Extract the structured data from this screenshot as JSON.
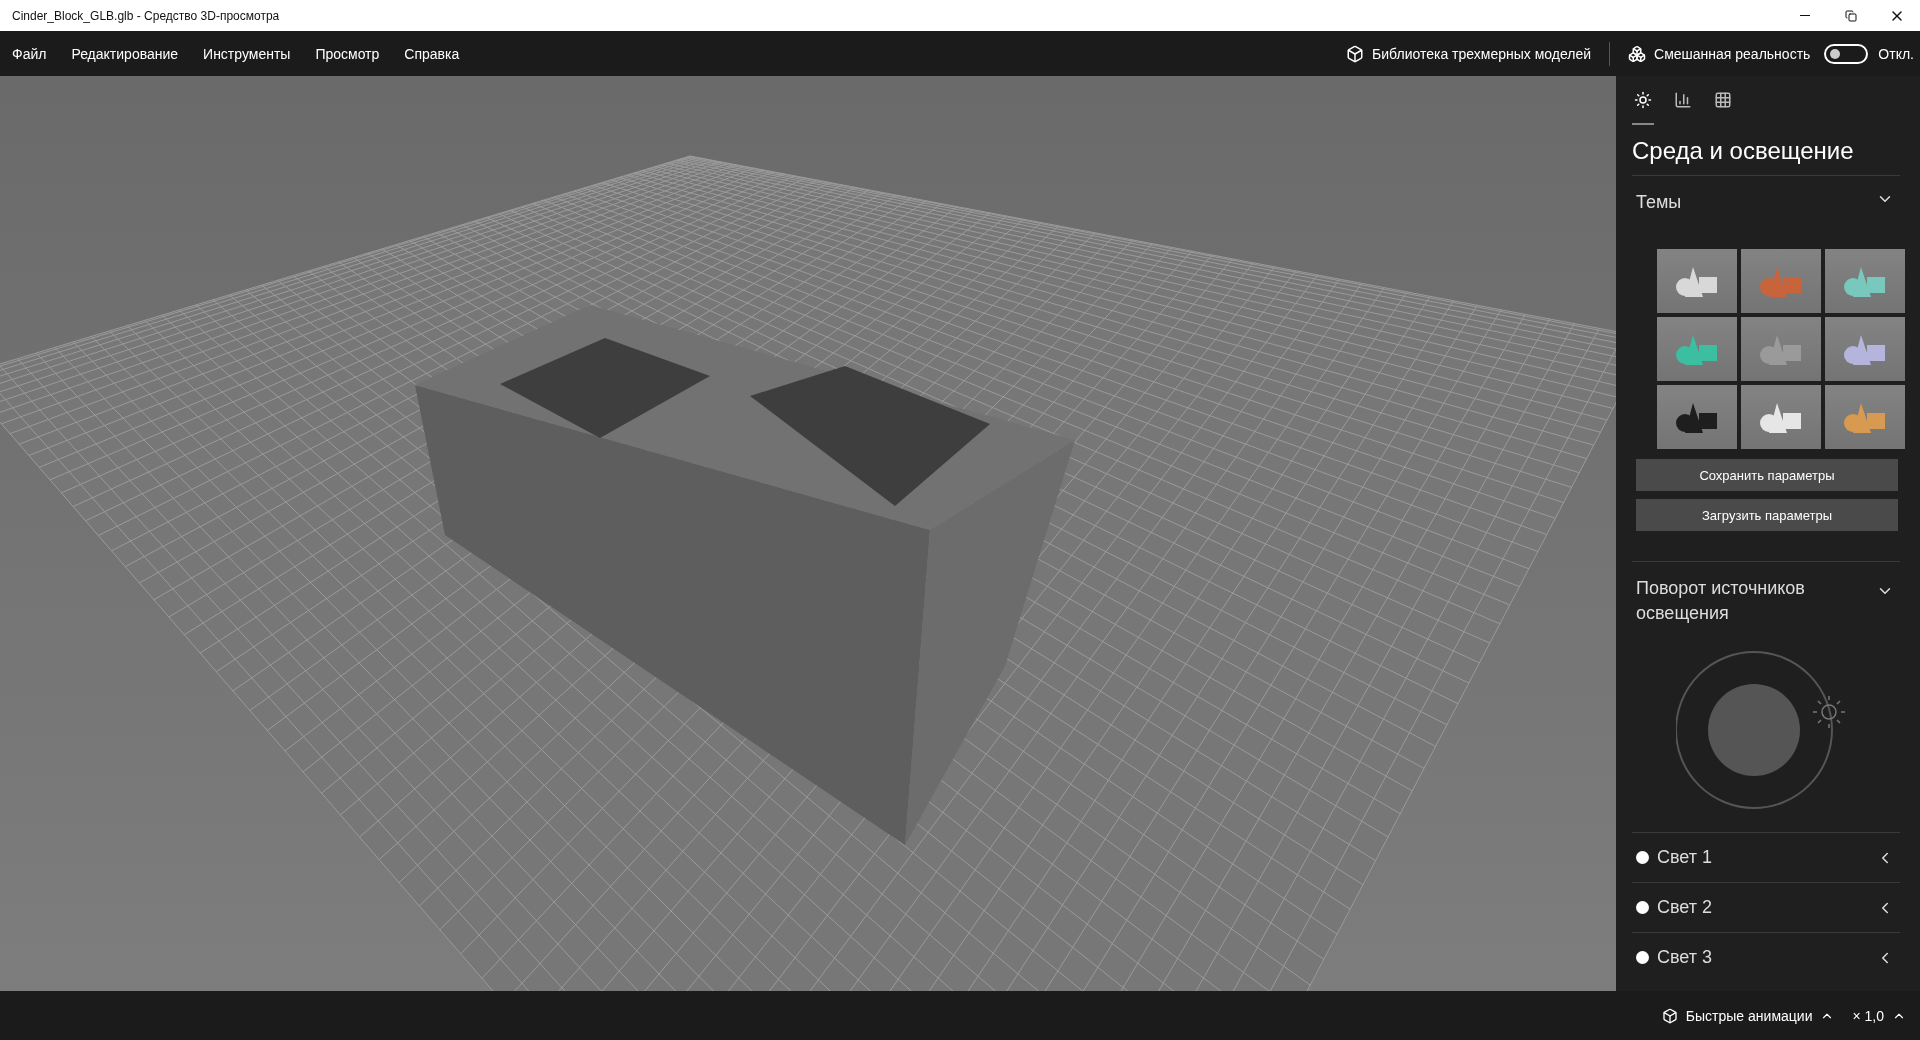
{
  "window": {
    "title": "Cinder_Block_GLB.glb - Средство 3D-просмотра"
  },
  "menu": [
    "Файл",
    "Редактирование",
    "Инструменты",
    "Просмотр",
    "Справка"
  ],
  "toolbar": {
    "library": "Библиотека трехмерных моделей",
    "mixed_reality": {
      "label": "Смешанная реальность",
      "on": false,
      "state_text": "Откл."
    }
  },
  "panel": {
    "tabs": [
      {
        "kind": "lighting",
        "selected": true
      },
      {
        "kind": "stats",
        "selected": false
      },
      {
        "kind": "grid",
        "selected": false
      }
    ],
    "title": "Среда и освещение",
    "themes": {
      "title": "Темы",
      "expanded": true,
      "items": [
        {
          "color": "#d8d8d8"
        },
        {
          "color": "#c8643c"
        },
        {
          "color": "#78c8be"
        },
        {
          "color": "#3cbea0"
        },
        {
          "color": "#9a9a9a"
        },
        {
          "color": "#b4b4dc"
        },
        {
          "color": "#1e1e1e"
        },
        {
          "color": "#e6e6e6"
        },
        {
          "color": "#d89a50"
        }
      ]
    },
    "buttons": [
      "Сохранить параметры",
      "Загрузить параметры"
    ],
    "rotation": {
      "title": "Поворот источников освещения",
      "expanded": true
    },
    "lights": [
      {
        "label": "Свет 1"
      },
      {
        "label": "Свет 2"
      },
      {
        "label": "Свет 3"
      }
    ]
  },
  "status_bar": {
    "animations": "Быстрые анимации",
    "speed": "× 1,0"
  }
}
